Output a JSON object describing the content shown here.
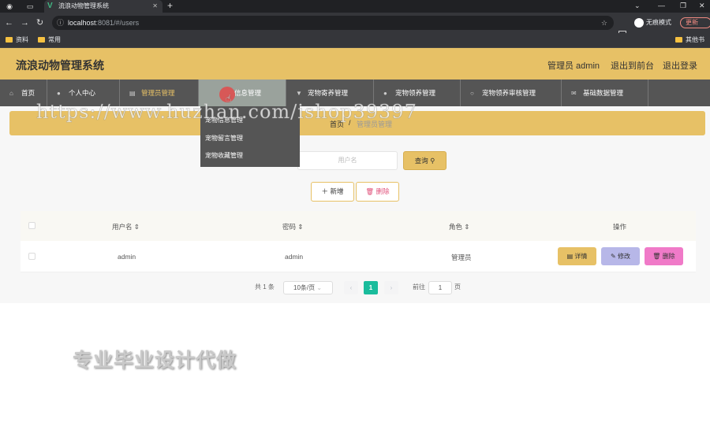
{
  "browser": {
    "tab_title": "流浪动物管理系统",
    "url_host": "localhost",
    "url_path": ":8081/#/users",
    "incognito_label": "无痕模式",
    "update_label": "更新",
    "bookmarks": [
      "资料",
      "常用"
    ],
    "other_bookmarks": "其他书签"
  },
  "header": {
    "title": "流浪动物管理系统",
    "user_label": "管理员 admin",
    "frontend_link": "退出到前台",
    "logout_link": "退出登录"
  },
  "menu": {
    "items": [
      {
        "label": "首页",
        "icon": "home-icon"
      },
      {
        "label": "个人中心",
        "icon": "user-icon"
      },
      {
        "label": "管理员管理",
        "icon": "doc-icon"
      },
      {
        "label": "宠物信息管理",
        "icon": "doc-icon"
      },
      {
        "label": "宠物寄养管理",
        "icon": "pet-icon"
      },
      {
        "label": "宠物领养管理",
        "icon": "user-icon"
      },
      {
        "label": "宠物领养审核管理",
        "icon": "circle-icon"
      },
      {
        "label": "基础数据管理",
        "icon": "mail-icon"
      }
    ],
    "dropdown": [
      "宠物信息管理",
      "宠物留言管理",
      "宠物收藏管理"
    ],
    "hover_partial_label": "信息管理"
  },
  "breadcrumb": {
    "home": "首页",
    "separator": "/",
    "current": "管理员管理"
  },
  "search": {
    "placeholder": "用户名",
    "button": "查询"
  },
  "actions": {
    "add": "新增",
    "delete": "删除"
  },
  "table": {
    "columns": [
      "用户名",
      "密码",
      "角色",
      "操作"
    ],
    "rows": [
      {
        "username": "admin",
        "password": "admin",
        "role": "管理员"
      }
    ],
    "row_actions": {
      "detail": "详情",
      "edit": "修改",
      "delete": "删除"
    }
  },
  "pagination": {
    "total": "共 1 条",
    "page_size": "10条/页",
    "current_page": "1",
    "goto_label": "前往",
    "goto_value": "1",
    "page_unit": "页"
  },
  "overlay": {
    "watermark": "https://www.huzhan.com/ishop39397",
    "promo": "专业毕业设计代做"
  },
  "colors": {
    "accent": "#e7c166",
    "menu_bg": "#555555",
    "edit": "#b7b7e8",
    "delete": "#f07ac8"
  }
}
